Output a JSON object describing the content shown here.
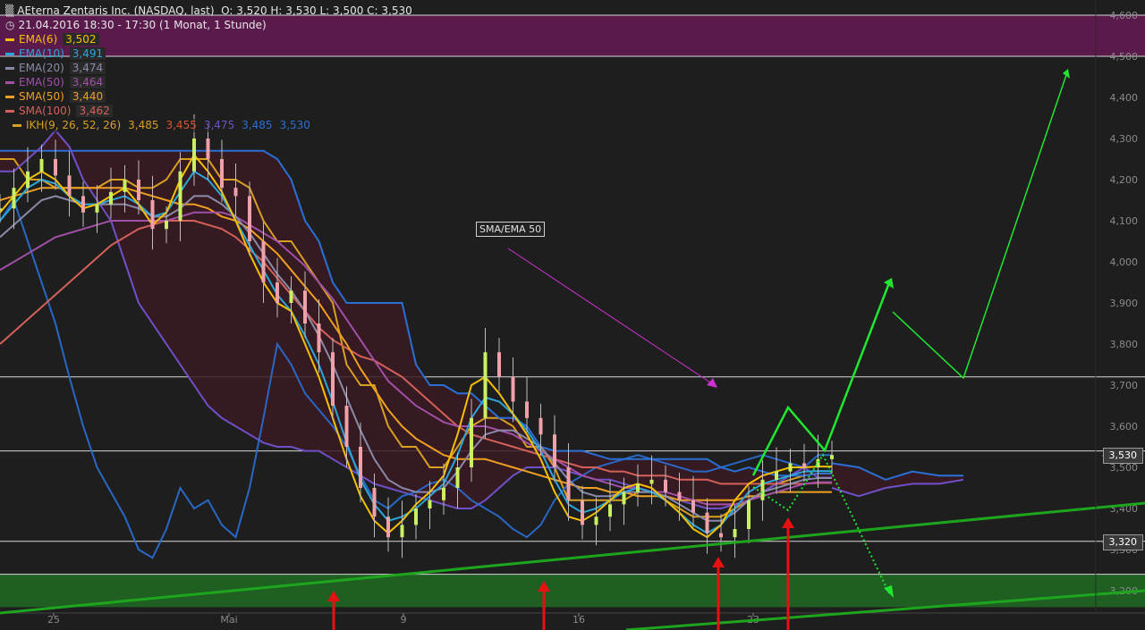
{
  "header": {
    "symbol_icon": "chart-bars-icon",
    "title": "AEterna Zentaris Inc. (NASDAQ, last)",
    "ohlc": "O: 3,520  H: 3,530  L: 3,500  C: 3,530",
    "clock_icon": "clock-icon",
    "period": "21.04.2016 18:30 - 17:30 (1 Monat, 1 Stunde)"
  },
  "legend": [
    {
      "label": "EMA(6)",
      "value": "3,502",
      "color": "#f5c000"
    },
    {
      "label": "EMA(10)",
      "value": "3,491",
      "color": "#2aa6d8"
    },
    {
      "label": "EMA(20)",
      "value": "3,474",
      "color": "#8a8aaa"
    },
    {
      "label": "EMA(50)",
      "value": "3,464",
      "color": "#a24fa8"
    },
    {
      "label": "SMA(50)",
      "value": "3,440",
      "color": "#f0a020"
    },
    {
      "label": "SMA(100)",
      "value": "3,462",
      "color": "#d4605a"
    }
  ],
  "ikh": {
    "label": "IKH(9, 26, 52, 26)",
    "values": [
      "3,485",
      "3,455",
      "3,475",
      "3,485",
      "3,530"
    ],
    "colors": [
      "#d8a020",
      "#e05030",
      "#7050c8",
      "#2a6fd6",
      "#2a6fd6"
    ]
  },
  "annotation": "SMA/EMA 50",
  "price_tags": {
    "last": "3,530",
    "support": "3,320"
  },
  "chart_data": {
    "type": "candlestick",
    "ylim": [
      3.15,
      4.62
    ],
    "y_ticks": [
      "4,600",
      "4,500",
      "4,400",
      "4,300",
      "4,200",
      "4,100",
      "4,000",
      "3,900",
      "3,800",
      "3,700",
      "3,600",
      "3,500",
      "3,400",
      "3,300",
      "3,200"
    ],
    "x_ticks": [
      "25",
      "Mai",
      "9",
      "16",
      "23"
    ],
    "horizontal_lines": [
      4.6,
      4.5,
      3.72,
      3.54,
      3.32,
      3.24
    ],
    "zones": [
      {
        "from": 4.5,
        "to": 4.6,
        "color": "#5a1a4c"
      },
      {
        "from": 3.16,
        "to": 3.24,
        "color": "#1f5f22"
      }
    ],
    "close_series": [
      4.13,
      4.18,
      4.22,
      4.25,
      4.21,
      4.16,
      4.12,
      4.14,
      4.17,
      4.2,
      4.15,
      4.08,
      4.1,
      4.22,
      4.3,
      4.25,
      4.18,
      4.16,
      4.05,
      3.95,
      3.9,
      3.93,
      3.85,
      3.78,
      3.65,
      3.55,
      3.45,
      3.38,
      3.33,
      3.36,
      3.4,
      3.42,
      3.45,
      3.5,
      3.62,
      3.78,
      3.72,
      3.66,
      3.62,
      3.58,
      3.5,
      3.42,
      3.36,
      3.38,
      3.41,
      3.44,
      3.46,
      3.47,
      3.44,
      3.42,
      3.39,
      3.34,
      3.33,
      3.35,
      3.42,
      3.47,
      3.49,
      3.51,
      3.5,
      3.52,
      3.53
    ],
    "ema_series": [
      {
        "name": "EMA(6)",
        "values": [
          4.12,
          4.16,
          4.2,
          4.22,
          4.2,
          4.16,
          4.13,
          4.14,
          4.16,
          4.18,
          4.14,
          4.09,
          4.12,
          4.2,
          4.26,
          4.22,
          4.17,
          4.1,
          4.02,
          3.95,
          3.9,
          3.88,
          3.8,
          3.72,
          3.62,
          3.52,
          3.43,
          3.37,
          3.34,
          3.37,
          3.41,
          3.44,
          3.48,
          3.58,
          3.7,
          3.72,
          3.68,
          3.63,
          3.58,
          3.52,
          3.44,
          3.38,
          3.37,
          3.39,
          3.42,
          3.45,
          3.46,
          3.45,
          3.42,
          3.39,
          3.35,
          3.33,
          3.36,
          3.42,
          3.46,
          3.48,
          3.49,
          3.5,
          3.5,
          3.502,
          3.502
        ]
      },
      {
        "name": "EMA(10)",
        "values": [
          4.1,
          4.14,
          4.18,
          4.2,
          4.19,
          4.16,
          4.14,
          4.14,
          4.15,
          4.16,
          4.14,
          4.11,
          4.12,
          4.17,
          4.22,
          4.2,
          4.16,
          4.1,
          4.04,
          3.98,
          3.92,
          3.88,
          3.82,
          3.75,
          3.66,
          3.56,
          3.47,
          3.41,
          3.37,
          3.38,
          3.4,
          3.43,
          3.46,
          3.53,
          3.62,
          3.67,
          3.66,
          3.63,
          3.59,
          3.54,
          3.47,
          3.41,
          3.39,
          3.4,
          3.42,
          3.44,
          3.45,
          3.44,
          3.42,
          3.39,
          3.36,
          3.34,
          3.36,
          3.4,
          3.44,
          3.46,
          3.47,
          3.48,
          3.49,
          3.491,
          3.491
        ]
      },
      {
        "name": "EMA(20)",
        "values": [
          4.06,
          4.09,
          4.12,
          4.15,
          4.16,
          4.15,
          4.14,
          4.14,
          4.14,
          4.14,
          4.13,
          4.11,
          4.11,
          4.13,
          4.16,
          4.16,
          4.14,
          4.11,
          4.07,
          4.02,
          3.97,
          3.93,
          3.88,
          3.82,
          3.75,
          3.67,
          3.59,
          3.52,
          3.47,
          3.45,
          3.44,
          3.44,
          3.45,
          3.49,
          3.54,
          3.58,
          3.59,
          3.59,
          3.57,
          3.55,
          3.51,
          3.47,
          3.44,
          3.43,
          3.43,
          3.44,
          3.44,
          3.44,
          3.43,
          3.41,
          3.39,
          3.37,
          3.37,
          3.39,
          3.42,
          3.44,
          3.45,
          3.46,
          3.47,
          3.474,
          3.474
        ]
      },
      {
        "name": "EMA(50)",
        "values": [
          3.98,
          4.0,
          4.02,
          4.04,
          4.06,
          4.07,
          4.08,
          4.09,
          4.1,
          4.1,
          4.1,
          4.1,
          4.1,
          4.11,
          4.12,
          4.12,
          4.12,
          4.11,
          4.09,
          4.07,
          4.05,
          4.02,
          3.99,
          3.95,
          3.91,
          3.86,
          3.81,
          3.76,
          3.71,
          3.68,
          3.65,
          3.63,
          3.61,
          3.6,
          3.6,
          3.6,
          3.59,
          3.58,
          3.56,
          3.54,
          3.52,
          3.5,
          3.48,
          3.47,
          3.46,
          3.45,
          3.45,
          3.44,
          3.44,
          3.43,
          3.42,
          3.41,
          3.41,
          3.41,
          3.42,
          3.43,
          3.44,
          3.45,
          3.46,
          3.464,
          3.464
        ]
      },
      {
        "name": "SMA(50)",
        "values": [
          4.15,
          4.16,
          4.17,
          4.18,
          4.18,
          4.18,
          4.18,
          4.18,
          4.18,
          4.18,
          4.17,
          4.16,
          4.15,
          4.14,
          4.14,
          4.13,
          4.11,
          4.1,
          4.08,
          4.05,
          4.02,
          3.98,
          3.94,
          3.9,
          3.85,
          3.8,
          3.74,
          3.69,
          3.64,
          3.6,
          3.57,
          3.55,
          3.53,
          3.52,
          3.52,
          3.52,
          3.51,
          3.5,
          3.49,
          3.48,
          3.47,
          3.46,
          3.45,
          3.45,
          3.44,
          3.44,
          3.43,
          3.43,
          3.43,
          3.42,
          3.42,
          3.42,
          3.42,
          3.42,
          3.43,
          3.43,
          3.44,
          3.44,
          3.44,
          3.44,
          3.44
        ]
      },
      {
        "name": "SMA(100)",
        "values": [
          3.8,
          3.83,
          3.86,
          3.89,
          3.92,
          3.95,
          3.98,
          4.01,
          4.04,
          4.06,
          4.08,
          4.09,
          4.1,
          4.1,
          4.1,
          4.09,
          4.08,
          4.06,
          4.03,
          4.0,
          3.96,
          3.92,
          3.88,
          3.84,
          3.81,
          3.79,
          3.77,
          3.76,
          3.74,
          3.72,
          3.69,
          3.66,
          3.63,
          3.6,
          3.58,
          3.57,
          3.56,
          3.55,
          3.54,
          3.53,
          3.52,
          3.51,
          3.5,
          3.5,
          3.49,
          3.49,
          3.48,
          3.48,
          3.48,
          3.47,
          3.47,
          3.47,
          3.46,
          3.46,
          3.46,
          3.46,
          3.46,
          3.46,
          3.46,
          3.462,
          3.462
        ]
      }
    ],
    "ikh_lines": [
      {
        "name": "Kijun",
        "values": [
          4.25,
          4.25,
          4.2,
          4.2,
          4.18,
          4.18,
          4.18,
          4.18,
          4.2,
          4.2,
          4.18,
          4.18,
          4.2,
          4.25,
          4.25,
          4.25,
          4.2,
          4.2,
          4.18,
          4.1,
          4.05,
          4.05,
          4.0,
          3.95,
          3.9,
          3.75,
          3.7,
          3.7,
          3.6,
          3.55,
          3.55,
          3.5,
          3.5,
          3.55,
          3.6,
          3.62,
          3.62,
          3.6,
          3.55,
          3.55,
          3.5,
          3.42,
          3.42,
          3.42,
          3.42,
          3.42,
          3.44,
          3.44,
          3.42,
          3.4,
          3.38,
          3.38,
          3.38,
          3.4,
          3.42,
          3.44,
          3.46,
          3.47,
          3.48,
          3.485,
          3.485
        ]
      },
      {
        "name": "Senkou B",
        "values": [
          4.27,
          4.27,
          4.27,
          4.27,
          4.27,
          4.27,
          4.27,
          4.27,
          4.27,
          4.27,
          4.27,
          4.27,
          4.27,
          4.27,
          4.27,
          4.27,
          4.27,
          4.27,
          4.27,
          4.27,
          4.25,
          4.2,
          4.1,
          4.05,
          3.95,
          3.9,
          3.9,
          3.9,
          3.9,
          3.9,
          3.75,
          3.7,
          3.7,
          3.68,
          3.68,
          3.65,
          3.62,
          3.62,
          3.6,
          3.55,
          3.54,
          3.54,
          3.54,
          3.53,
          3.52,
          3.52,
          3.52,
          3.52,
          3.52,
          3.52,
          3.52,
          3.52,
          3.5,
          3.49,
          3.5,
          3.49,
          3.48,
          3.48,
          3.48,
          3.485,
          3.485
        ]
      },
      {
        "name": "Senkou A",
        "values": [
          4.22,
          4.22,
          4.25,
          4.28,
          4.32,
          4.28,
          4.2,
          4.15,
          4.1,
          4.0,
          3.9,
          3.85,
          3.8,
          3.75,
          3.7,
          3.65,
          3.62,
          3.6,
          3.58,
          3.56,
          3.55,
          3.55,
          3.54,
          3.54,
          3.52,
          3.5,
          3.48,
          3.46,
          3.45,
          3.44,
          3.43,
          3.42,
          3.41,
          3.4,
          3.4,
          3.42,
          3.45,
          3.48,
          3.5,
          3.5,
          3.5,
          3.49,
          3.48,
          3.47,
          3.47,
          3.46,
          3.45,
          3.44,
          3.43,
          3.42,
          3.41,
          3.4,
          3.4,
          3.41,
          3.42,
          3.44,
          3.46,
          3.48,
          3.5,
          3.475,
          3.475
        ]
      },
      {
        "name": "Chikou",
        "values": [
          4.1,
          4.15,
          4.05,
          3.95,
          3.85,
          3.72,
          3.6,
          3.5,
          3.44,
          3.38,
          3.3,
          3.28,
          3.35,
          3.45,
          3.4,
          3.42,
          3.36,
          3.33,
          3.45,
          3.62,
          3.8,
          3.75,
          3.68,
          3.64,
          3.6,
          3.55,
          3.48,
          3.42,
          3.4,
          3.43,
          3.44,
          3.46,
          3.47,
          3.45,
          3.42,
          3.4,
          3.38,
          3.35,
          3.33,
          3.36,
          3.42,
          3.46,
          3.48,
          3.5,
          3.51,
          3.52,
          3.53,
          3.52,
          3.51,
          3.5,
          3.49,
          3.49,
          3.5,
          3.51,
          3.52,
          3.53,
          3.52,
          3.51,
          3.5,
          3.53,
          3.53
        ]
      }
    ],
    "trend_lines": [
      {
        "from": [
          "start",
          3.15
        ],
        "to": [
          "end",
          3.41
        ],
        "color": "#1ea51e"
      },
      {
        "from": [
          "mid",
          3.1
        ],
        "to": [
          "end",
          3.21
        ],
        "color": "#1ea51e"
      }
    ],
    "projection": {
      "label": "green arrow scenario"
    },
    "signals": [
      "up",
      "up",
      "up",
      "up"
    ]
  }
}
